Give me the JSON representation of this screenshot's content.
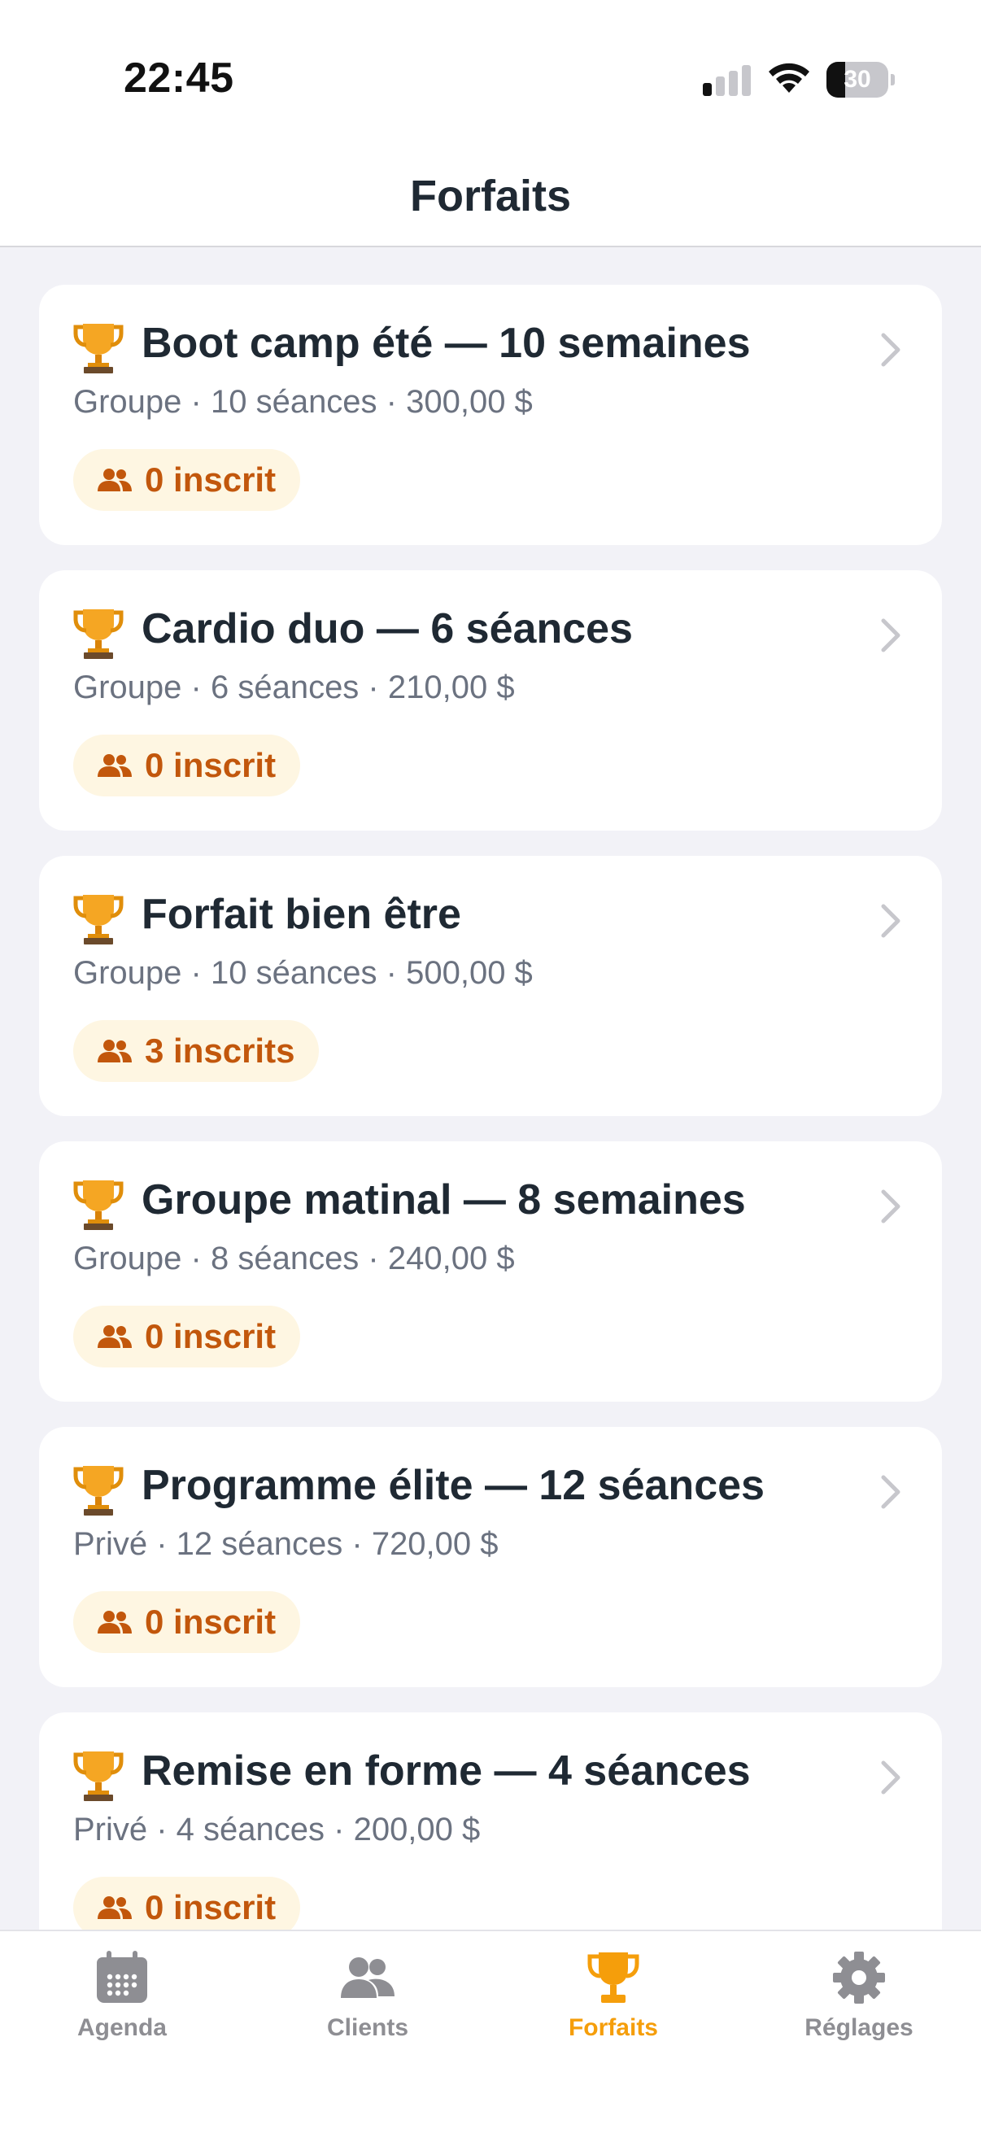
{
  "status_bar": {
    "time": "22:45",
    "battery_level": "30",
    "battery_percent": 30,
    "signal_bars_active": 1,
    "signal_bars_total": 4
  },
  "header": {
    "title": "Forfaits"
  },
  "packages": [
    {
      "icon": "trophy-icon",
      "title": "Boot camp été — 10 semaines",
      "subtitle": "Groupe · 10 séances · 300,00 $",
      "badge": "0 inscrit"
    },
    {
      "icon": "trophy-icon",
      "title": "Cardio duo — 6 séances",
      "subtitle": "Groupe · 6 séances · 210,00 $",
      "badge": "0 inscrit"
    },
    {
      "icon": "trophy-icon",
      "title": "Forfait bien être",
      "subtitle": "Groupe · 10 séances · 500,00 $",
      "badge": "3 inscrits"
    },
    {
      "icon": "trophy-icon",
      "title": "Groupe matinal — 8 semaines",
      "subtitle": "Groupe · 8 séances · 240,00 $",
      "badge": "0 inscrit"
    },
    {
      "icon": "trophy-icon",
      "title": "Programme élite — 12 séances",
      "subtitle": "Privé · 12 séances · 720,00 $",
      "badge": "0 inscrit"
    },
    {
      "icon": "trophy-icon",
      "title": "Remise en forme — 4 séances",
      "subtitle": "Privé · 4 séances · 200,00 $",
      "badge": "0 inscrit"
    }
  ],
  "tab_bar": {
    "tabs": [
      {
        "label": "Agenda",
        "icon": "calendar-icon",
        "active": false
      },
      {
        "label": "Clients",
        "icon": "people-icon",
        "active": false
      },
      {
        "label": "Forfaits",
        "icon": "trophy-icon",
        "active": true
      },
      {
        "label": "Réglages",
        "icon": "gear-icon",
        "active": false
      }
    ]
  },
  "colors": {
    "accent": "#f59e0b",
    "badge_text": "#c2570c",
    "badge_bg": "#fef6e2",
    "inactive_tab": "#8e8e93",
    "title_text": "#1f2933",
    "subtitle_text": "#6b7280",
    "background": "#f2f2f7"
  }
}
